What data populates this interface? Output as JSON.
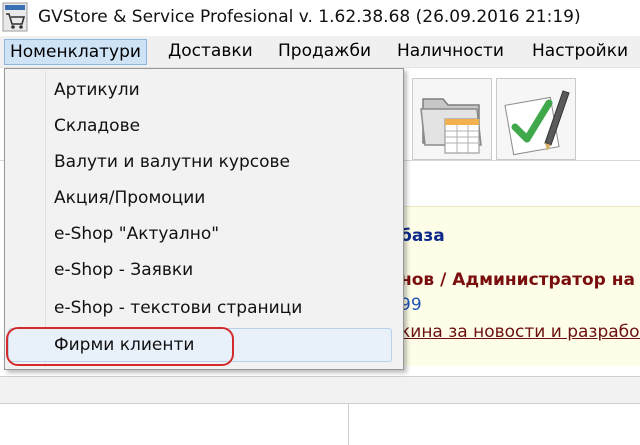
{
  "window": {
    "title": "GVStore & Service Profesional v. 1.62.38.68 (26.09.2016 21:19)",
    "icon": "shopping-cart-icon"
  },
  "menubar": {
    "items": [
      {
        "label": "Номенклатури",
        "active": true
      },
      {
        "label": "Доставки"
      },
      {
        "label": "Продажби"
      },
      {
        "label": "Наличности"
      },
      {
        "label": "Настройки"
      }
    ]
  },
  "toolbar": {
    "icons": [
      "folder-table-icon",
      "document-pen-icon"
    ]
  },
  "dropdown": {
    "items": [
      {
        "label": "Артикули"
      },
      {
        "label": "Складове"
      },
      {
        "label": "Валути и валутни курсове"
      },
      {
        "label": "Акция/Промоции"
      },
      {
        "label": "e-Shop \"Актуално\""
      },
      {
        "label": "e-Shop - Заявки"
      },
      {
        "label": "e-Shop - текстови страници"
      },
      {
        "label": "Фирми клиенти",
        "highlighted": true
      }
    ],
    "highlight_color": "#d32b2b"
  },
  "content": {
    "base_text": "база",
    "admin_text": "нов / Администратор на",
    "number_text": "99",
    "link_text": "кина за новости и разработки"
  }
}
